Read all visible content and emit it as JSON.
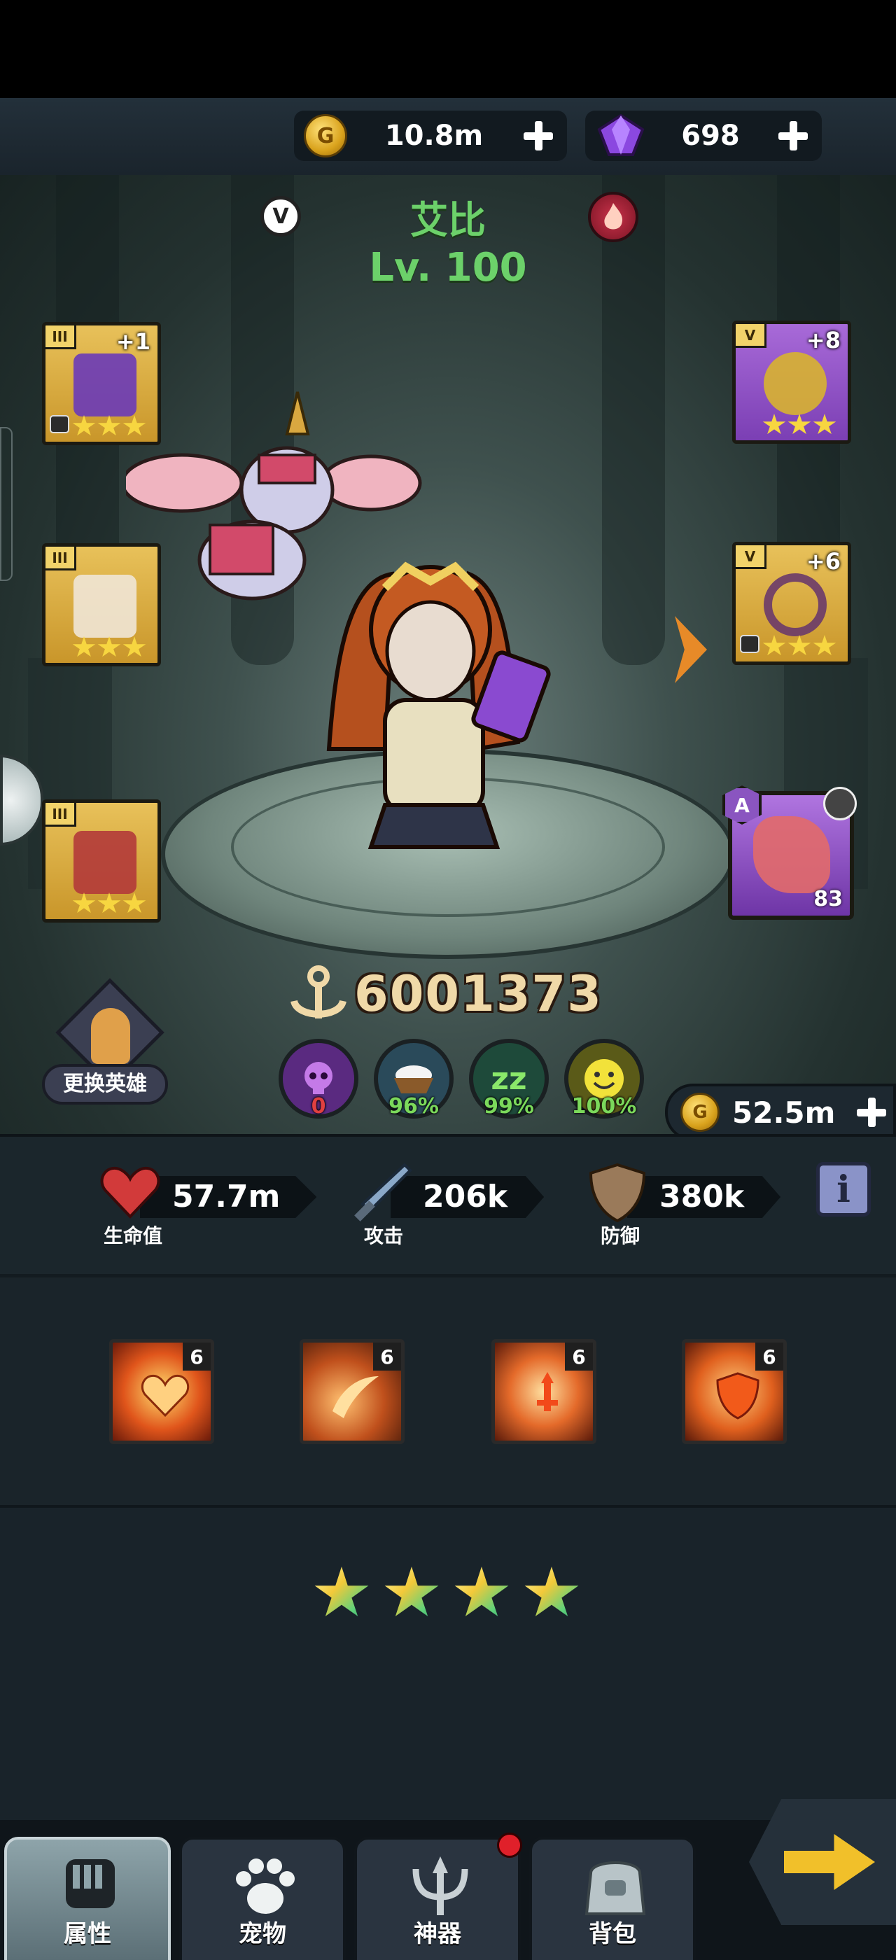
{
  "currency": {
    "gold": {
      "value": "10.8m",
      "icon": "gold-coin-icon",
      "coin_letter": "G"
    },
    "gems": {
      "value": "698",
      "icon": "purple-gem-icon"
    }
  },
  "hero": {
    "name": "艾比",
    "level": "Lv. 100",
    "v_badge": "V",
    "element_icon": "fire-icon",
    "power": "6001373",
    "swap_label": "更换英雄"
  },
  "equipment": {
    "left": [
      {
        "name": "weapon",
        "tier": "III",
        "plus": "+1",
        "stars": 3,
        "locked": true,
        "color": "gold"
      },
      {
        "name": "armor",
        "tier": "III",
        "plus": "",
        "stars": 3,
        "locked": false,
        "color": "gold"
      },
      {
        "name": "belt-armor",
        "tier": "III",
        "plus": "",
        "stars": 3,
        "locked": false,
        "color": "gold"
      }
    ],
    "right": [
      {
        "name": "ring",
        "tier": "V",
        "plus": "+8",
        "stars": 3,
        "locked": false,
        "color": "purple"
      },
      {
        "name": "necklace",
        "tier": "V",
        "plus": "+6",
        "stars": 3,
        "locked": true,
        "color": "gold"
      }
    ],
    "artifact": {
      "rank": "A",
      "level": "83",
      "locked": true
    }
  },
  "status_badges": [
    {
      "icon": "skull-icon",
      "value": "0",
      "color": "#e04040"
    },
    {
      "icon": "food-bowl-icon",
      "value": "96%",
      "color": "#7bd95b"
    },
    {
      "icon": "sleep-icon",
      "value": "99%",
      "color": "#7bd95b"
    },
    {
      "icon": "smile-icon",
      "value": "100%",
      "color": "#7bd95b"
    }
  ],
  "upgrade_gold": {
    "value": "52.5m",
    "coin_letter": "G"
  },
  "stats": {
    "hp": {
      "label": "生命值",
      "value": "57.7m",
      "icon": "heart-icon"
    },
    "attack": {
      "label": "攻击",
      "value": "206k",
      "icon": "sword-icon"
    },
    "defense": {
      "label": "防御",
      "value": "380k",
      "icon": "shield-icon"
    },
    "info_label": "i"
  },
  "skills": [
    {
      "icon": "heart-burst-skill-icon",
      "level": "6"
    },
    {
      "icon": "fire-slash-skill-icon",
      "level": "6"
    },
    {
      "icon": "sword-burst-skill-icon",
      "level": "6"
    },
    {
      "icon": "shield-burst-skill-icon",
      "level": "6"
    }
  ],
  "hero_stars": 4,
  "nav": [
    {
      "label": "属性",
      "icon": "fist-icon",
      "active": true
    },
    {
      "label": "宠物",
      "icon": "paw-icon",
      "active": false
    },
    {
      "label": "神器",
      "icon": "trident-icon",
      "active": false,
      "notification": true
    },
    {
      "label": "背包",
      "icon": "bag-icon",
      "active": false
    }
  ],
  "colors": {
    "hero_name": "#6cd16a",
    "accent_gold": "#f7d640",
    "arrow_orange": "#e78a28"
  }
}
